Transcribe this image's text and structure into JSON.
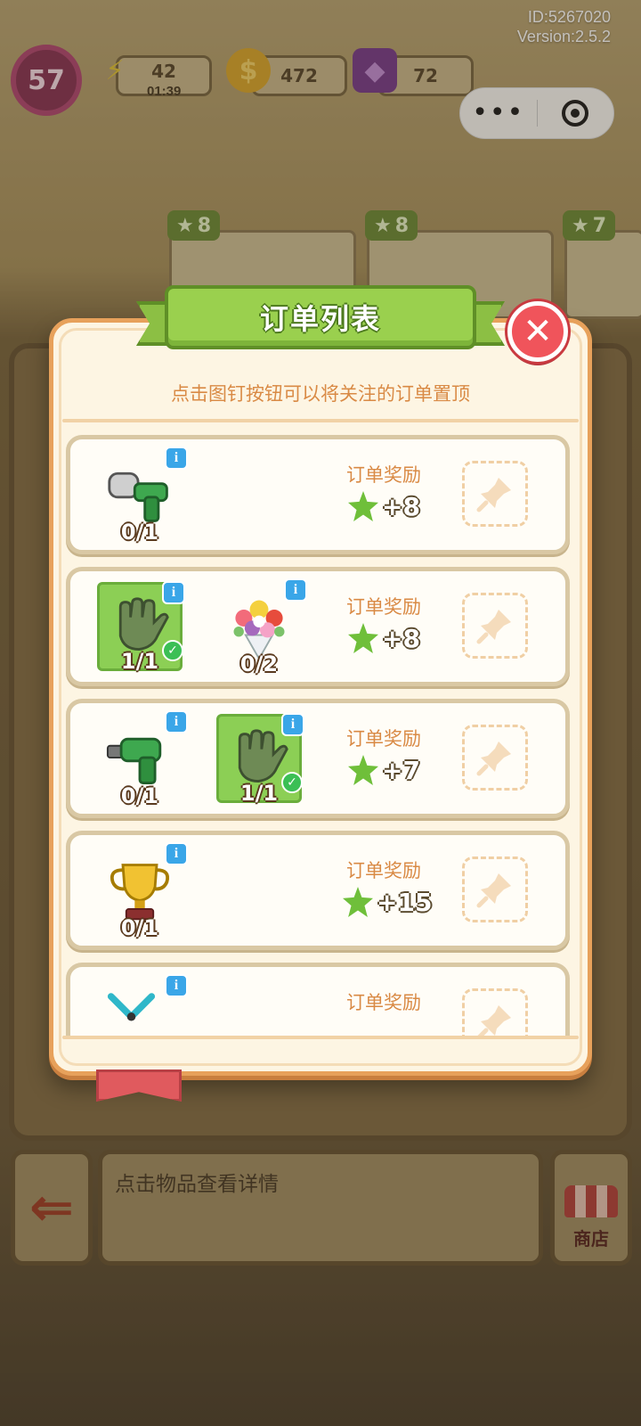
{
  "hud": {
    "id_text": "ID:5267020",
    "version_text": "Version:2.5.2",
    "level": "57",
    "energy": "42",
    "energy_timer": "01:39",
    "coins": "472",
    "gems": "72"
  },
  "background_orders": [
    {
      "badge": "8"
    },
    {
      "badge": "8"
    },
    {
      "badge": "7"
    }
  ],
  "modal": {
    "title": "订单列表",
    "hint": "点击图钉按钮可以将关注的订单置顶",
    "orders": [
      {
        "items": [
          {
            "icon": "drill-icon",
            "count": "0/1",
            "done": false
          }
        ],
        "reward_label": "订单奖励",
        "reward": "+8"
      },
      {
        "items": [
          {
            "icon": "glove-icon",
            "count": "1/1",
            "done": true
          },
          {
            "icon": "flower-bouquet-icon",
            "count": "0/2",
            "done": false
          }
        ],
        "reward_label": "订单奖励",
        "reward": "+8"
      },
      {
        "items": [
          {
            "icon": "drill-icon",
            "count": "0/1",
            "done": false
          },
          {
            "icon": "glove-icon",
            "count": "1/1",
            "done": true
          }
        ],
        "reward_label": "订单奖励",
        "reward": "+7"
      },
      {
        "items": [
          {
            "icon": "trophy-icon",
            "count": "0/1",
            "done": false
          }
        ],
        "reward_label": "订单奖励",
        "reward": "+15"
      },
      {
        "items": [
          {
            "icon": "scissors-icon",
            "count": "",
            "done": false
          }
        ],
        "reward_label": "订单奖励",
        "reward": ""
      }
    ]
  },
  "bottom": {
    "detail_placeholder": "点击物品查看详情",
    "shop_label": "商店"
  },
  "colors": {
    "accent_green": "#9ad04e",
    "modal_border": "#e7a15b",
    "hint_text": "#d98a45",
    "close_red": "#f0545b"
  }
}
